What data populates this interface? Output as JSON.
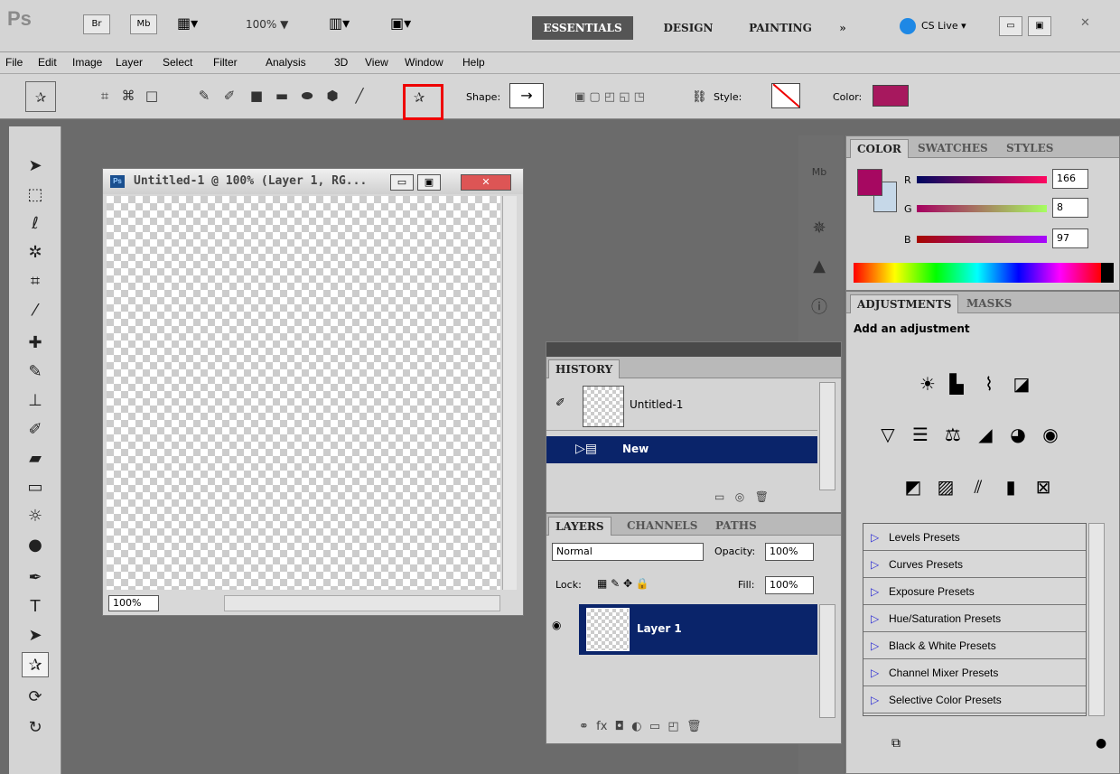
{
  "app": {
    "logo": "Ps",
    "bridge": "Br",
    "minibridge": "Mb",
    "zoom": "100% ▼",
    "workspaces": [
      "ESSENTIALS",
      "DESIGN",
      "PAINTING",
      "»"
    ],
    "cslive": "CS Live ▾"
  },
  "menu": [
    "File",
    "Edit",
    "Image",
    "Layer",
    "Select",
    "Filter",
    "Analysis",
    "3D",
    "View",
    "Window",
    "Help"
  ],
  "options": {
    "shape_label": "Shape:",
    "style_label": "Style:",
    "color_label": "Color:",
    "color_swatch": "#a7185e"
  },
  "document": {
    "title": "Untitled-1 @ 100% (Layer 1, RG...",
    "zoom": "100%"
  },
  "color_panel": {
    "tabs": [
      "COLOR",
      "SWATCHES",
      "STYLES"
    ],
    "channels": [
      {
        "label": "R",
        "value": "166"
      },
      {
        "label": "G",
        "value": "8"
      },
      {
        "label": "B",
        "value": "97"
      }
    ],
    "fg": "#a60861",
    "bg": "#c6d8e8"
  },
  "adjustments": {
    "tabs": [
      "ADJUSTMENTS",
      "MASKS"
    ],
    "heading": "Add an adjustment",
    "presets": [
      "Levels Presets",
      "Curves Presets",
      "Exposure Presets",
      "Hue/Saturation Presets",
      "Black & White Presets",
      "Channel Mixer Presets",
      "Selective Color Presets"
    ]
  },
  "history": {
    "tab": "HISTORY",
    "items": [
      "Untitled-1",
      "New"
    ]
  },
  "layers": {
    "tabs": [
      "LAYERS",
      "CHANNELS",
      "PATHS"
    ],
    "blend": "Normal",
    "opacity_label": "Opacity:",
    "opacity": "100%",
    "lock_label": "Lock:",
    "fill_label": "Fill:",
    "fill": "100%",
    "layer": "Layer 1"
  }
}
